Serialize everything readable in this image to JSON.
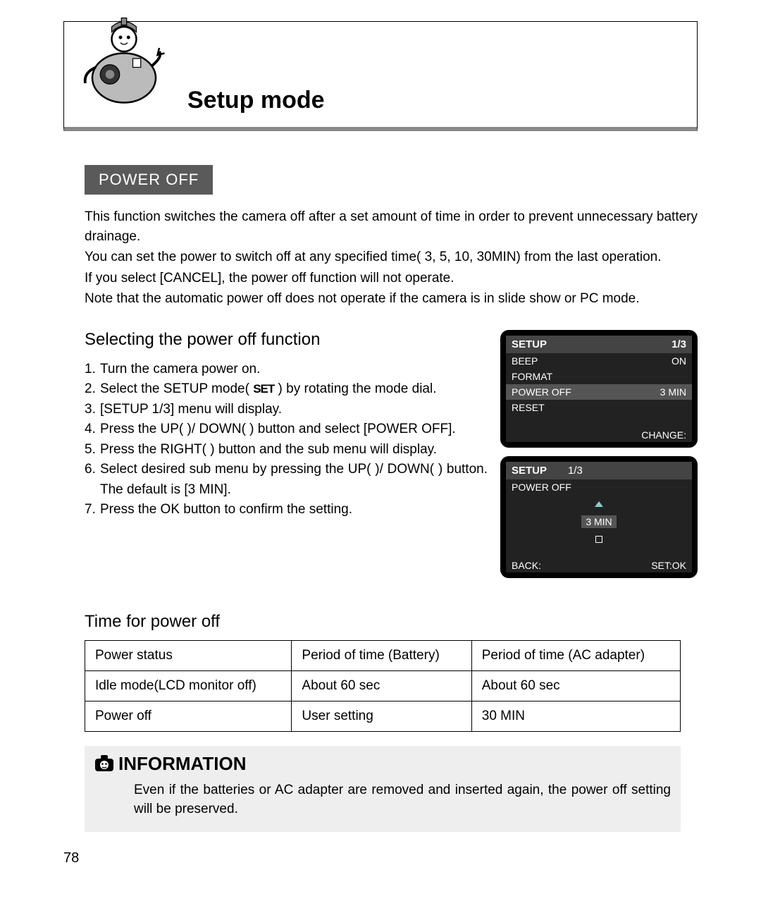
{
  "header": {
    "title": "Setup mode"
  },
  "section": {
    "label": "POWER OFF"
  },
  "description": {
    "p1": "This function switches the camera off after a set amount of time in order to prevent unnecessary battery drainage.",
    "p2": "You can set the power to switch off at any specified time( 3, 5, 10, 30MIN) from the last operation.",
    "p3": "If you select [CANCEL], the power off function will not operate.",
    "p4": "Note that the automatic power off does not operate if the camera is in slide show or PC mode."
  },
  "subhead1": "Selecting the power off function",
  "steps": [
    "Turn the camera power on.",
    "Select the SETUP mode( SET ) by rotating the mode dial.",
    "[SETUP 1/3] menu will display.",
    "Press the UP(   )/ DOWN(   ) button and select [POWER OFF].",
    "Press the RIGHT(   ) button and the sub menu will display.",
    "Select desired sub menu by pressing the UP(   )/ DOWN(   ) button. The default is [3 MIN].",
    "Press the OK button to confirm the setting."
  ],
  "step2_set_label": "SET",
  "lcd1": {
    "title": "SETUP",
    "page": "1/3",
    "rows": [
      {
        "l": "BEEP",
        "r": "ON",
        "hl": false
      },
      {
        "l": "FORMAT",
        "r": "",
        "hl": false
      },
      {
        "l": "POWER OFF",
        "r": "3 MIN",
        "hl": true
      },
      {
        "l": "RESET",
        "r": "",
        "hl": false
      }
    ],
    "foot_r": "CHANGE:"
  },
  "lcd2": {
    "title": "SETUP",
    "page": "1/3",
    "label": "POWER OFF",
    "value": "3 MIN",
    "foot_l": "BACK:",
    "foot_r": "SET:OK"
  },
  "subhead2": "Time for power off",
  "table": {
    "headers": [
      "Power status",
      "Period of time (Battery)",
      "Period of time (AC adapter)"
    ],
    "rows": [
      [
        "Idle mode(LCD monitor off)",
        "About 60 sec",
        "About 60 sec"
      ],
      [
        "Power off",
        "User setting",
        "30 MIN"
      ]
    ]
  },
  "info": {
    "title": "INFORMATION",
    "text": "Even if the batteries or AC adapter are removed and inserted again, the power off setting will be preserved."
  },
  "page_number": "78"
}
